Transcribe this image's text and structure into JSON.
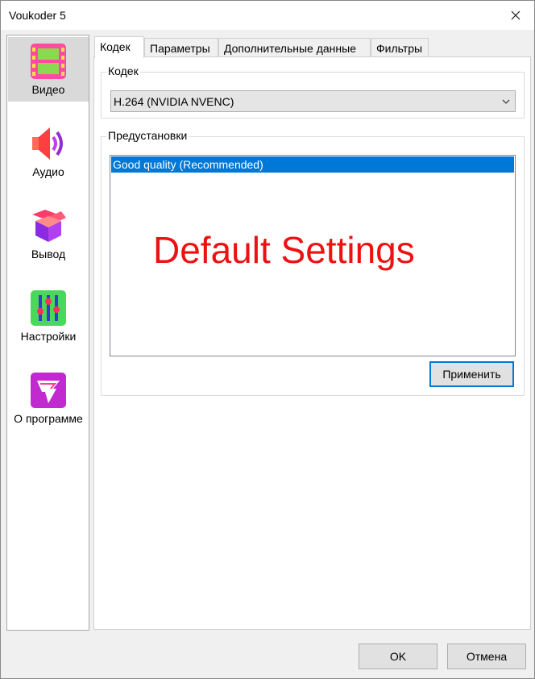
{
  "window": {
    "title": "Voukoder 5"
  },
  "sidebar": {
    "items": [
      {
        "label": "Видео",
        "icon": "film-icon"
      },
      {
        "label": "Аудио",
        "icon": "speaker-icon"
      },
      {
        "label": "Вывод",
        "icon": "box-icon"
      },
      {
        "label": "Настройки",
        "icon": "sliders-icon"
      },
      {
        "label": "О программе",
        "icon": "info-logo-icon"
      }
    ],
    "active": "Видео"
  },
  "tabs": [
    {
      "label": "Кодек"
    },
    {
      "label": "Параметры"
    },
    {
      "label": "Дополнительные данные"
    },
    {
      "label": "Фильтры"
    }
  ],
  "codec_group": {
    "label": "Кодек",
    "selected": "H.264 (NVIDIA NVENC)"
  },
  "presets_group": {
    "label": "Предустановки",
    "items": [
      "Good quality (Recommended)"
    ],
    "apply_label": "Применить"
  },
  "overlay_text": "Default Settings",
  "footer": {
    "ok_label": "OK",
    "cancel_label": "Отмена"
  },
  "colors": {
    "selection": "#0078d7",
    "overlay": "#ee1111"
  }
}
